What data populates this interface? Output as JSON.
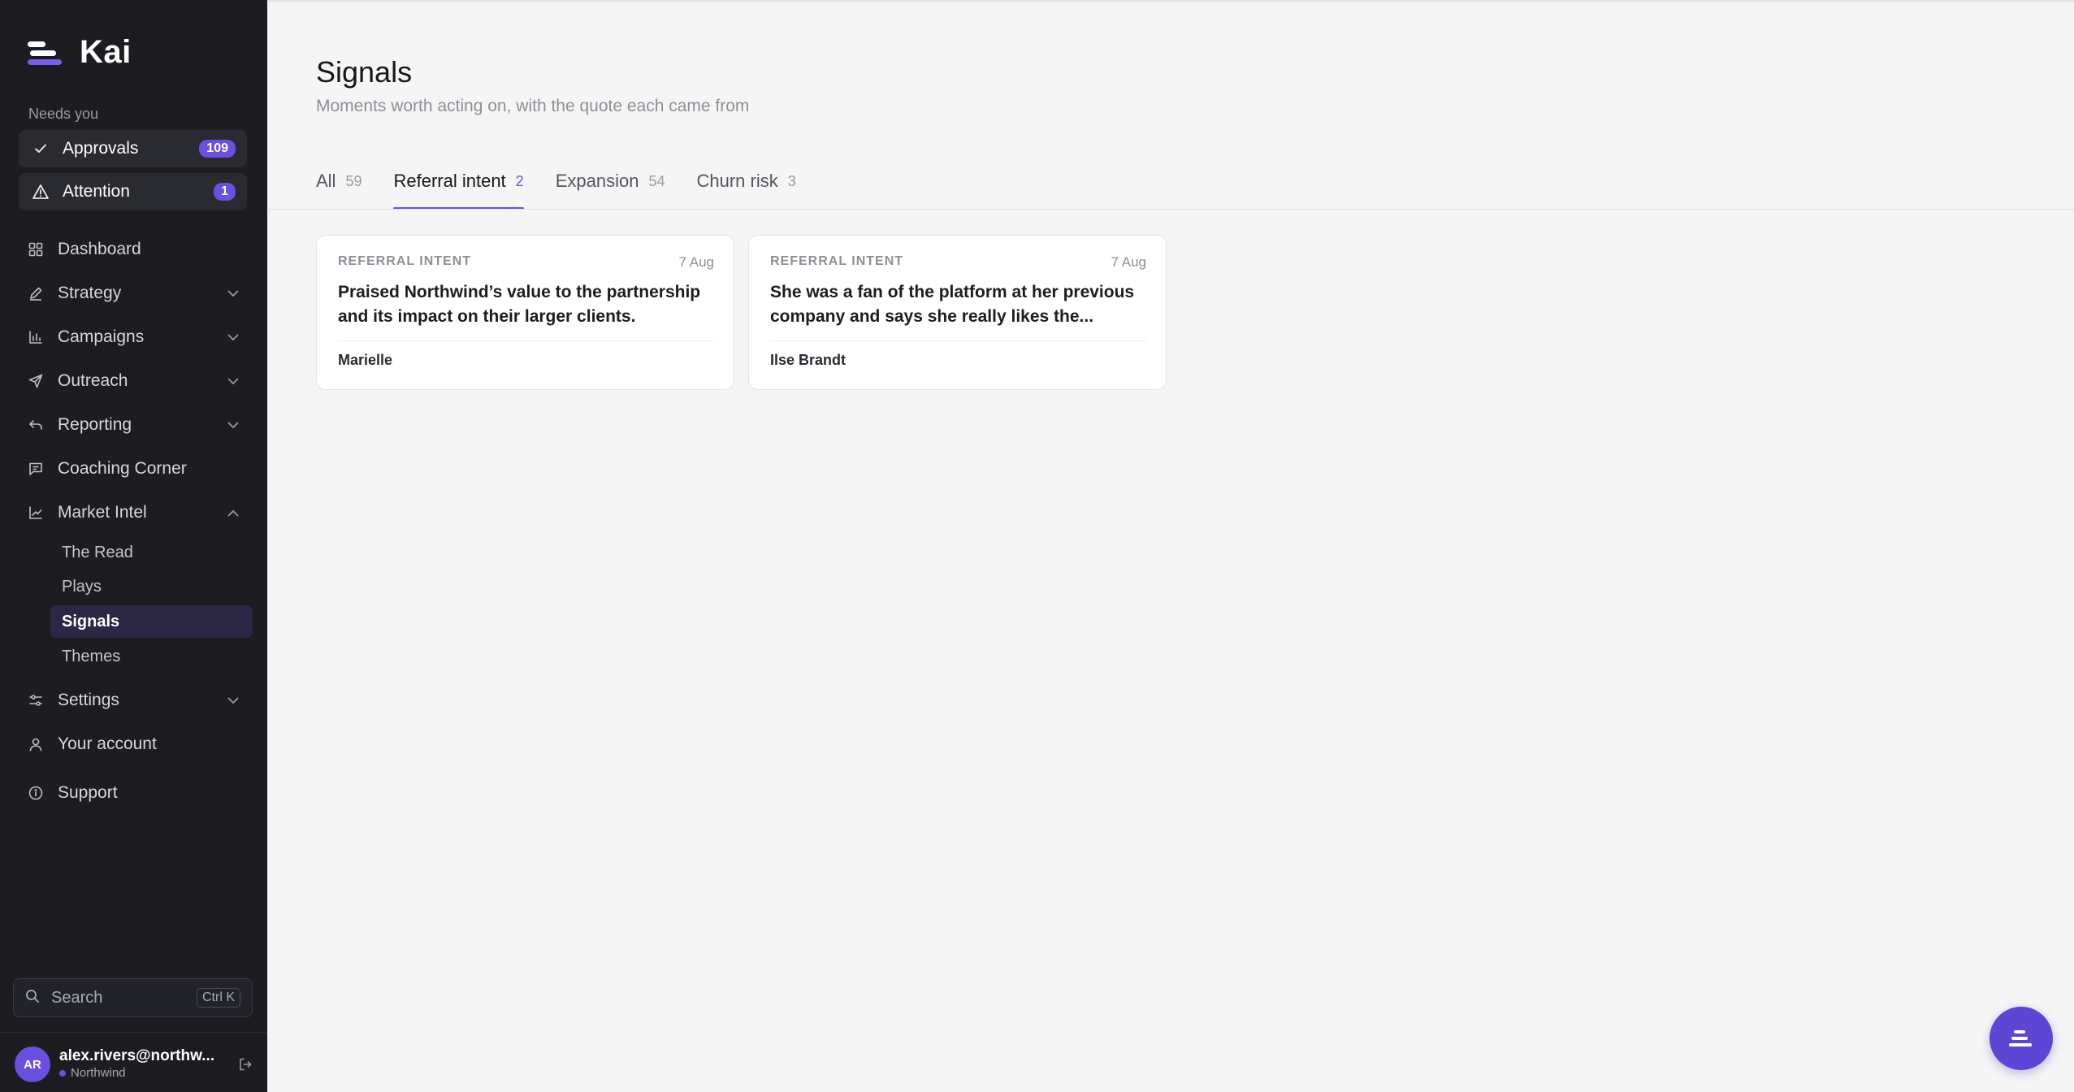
{
  "app": {
    "name": "Kai"
  },
  "sidebar": {
    "section_label": "Needs you",
    "pills": [
      {
        "label": "Approvals",
        "badge": "109",
        "icon": "check-icon"
      },
      {
        "label": "Attention",
        "badge": "1",
        "icon": "warning-icon"
      }
    ],
    "nav": [
      {
        "label": "Dashboard",
        "icon": "grid-icon"
      },
      {
        "label": "Strategy",
        "icon": "pen-icon"
      },
      {
        "label": "Campaigns",
        "icon": "bar-chart-icon"
      },
      {
        "label": "Outreach",
        "icon": "send-icon"
      },
      {
        "label": "Reporting",
        "icon": "reply-icon"
      },
      {
        "label": "Coaching Corner",
        "icon": "message-icon"
      },
      {
        "label": "Market Intel",
        "icon": "trend-icon"
      },
      {
        "label": "Settings",
        "icon": "sliders-icon"
      },
      {
        "label": "Your account",
        "icon": "user-icon"
      },
      {
        "label": "Support",
        "icon": "info-icon"
      }
    ],
    "market_intel_sub": [
      {
        "label": "The Read"
      },
      {
        "label": "Plays"
      },
      {
        "label": "Signals"
      },
      {
        "label": "Themes"
      }
    ],
    "search": {
      "label": "Search",
      "shortcut": "Ctrl K"
    },
    "user": {
      "initials": "AR",
      "email": "alex.rivers@northw...",
      "org": "Northwind"
    }
  },
  "main": {
    "title": "Signals",
    "subtitle": "Moments worth acting on, with the quote each came from",
    "tabs": [
      {
        "label": "All",
        "count": "59"
      },
      {
        "label": "Referral intent",
        "count": "2"
      },
      {
        "label": "Expansion",
        "count": "54"
      },
      {
        "label": "Churn risk",
        "count": "3"
      }
    ],
    "cards": [
      {
        "type": "REFERRAL INTENT",
        "date": "7 Aug",
        "quote": "Praised Northwind’s value to the partnership and its impact on their larger clients.",
        "author": "Marielle"
      },
      {
        "type": "REFERRAL INTENT",
        "date": "7 Aug",
        "quote": "She was a fan of the platform at her previous company and says she really likes the...",
        "author": "Ilse Brandt"
      }
    ]
  },
  "colors": {
    "accent": "#6a4fe0",
    "sidebar_bg": "#1c1c21",
    "main_bg": "#f5f5f6"
  }
}
